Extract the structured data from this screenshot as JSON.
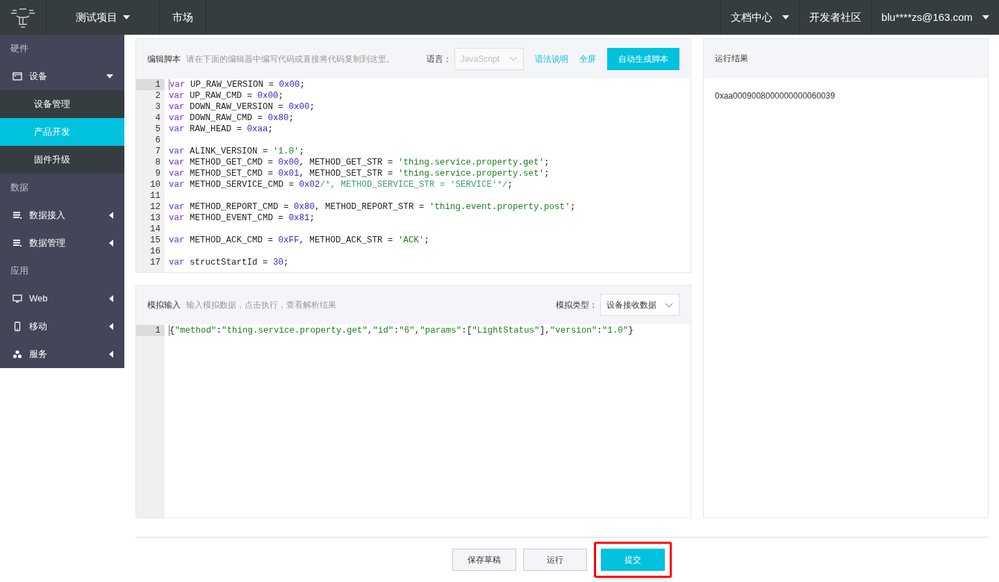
{
  "topbar": {
    "project_menu": "测试项目",
    "nav": [
      "市场"
    ],
    "right": [
      {
        "label": "文档中心",
        "kind": "menu"
      },
      {
        "label": "开发者社区",
        "kind": "link"
      },
      {
        "label": "blu****zs@163.com",
        "kind": "menu"
      }
    ]
  },
  "sidebar": {
    "sections": [
      {
        "title": "硬件",
        "items": [
          {
            "label": "设备",
            "kind": "window",
            "expanded": true,
            "children": [
              {
                "label": "设备管理",
                "selected": false
              },
              {
                "label": "产品开发",
                "selected": true
              },
              {
                "label": "固件升级",
                "selected": false
              }
            ]
          }
        ]
      },
      {
        "title": "数据",
        "items": [
          {
            "label": "数据接入",
            "kind": "list",
            "expanded": false
          },
          {
            "label": "数据管理",
            "kind": "list",
            "expanded": false
          }
        ]
      },
      {
        "title": "应用",
        "items": [
          {
            "label": "Web",
            "kind": "monitor",
            "expanded": false
          },
          {
            "label": "移动",
            "kind": "phone",
            "expanded": false
          },
          {
            "label": "服务",
            "kind": "cluster",
            "expanded": false
          }
        ]
      }
    ]
  },
  "editor": {
    "title": "编辑脚本",
    "hint": "请在下面的编辑器中编写代码或直接将代码复制到这里。",
    "language_label": "语言：",
    "language": "JavaScript",
    "links": [
      "语法说明",
      "全屏"
    ],
    "generate_button": "自动生成脚本",
    "lines": [
      {
        "number": "1",
        "active": true,
        "tokens": [
          {
            "kind": "k",
            "text": "var"
          },
          {
            "kind": "p",
            "text": " UP_RAW_VERSION = "
          },
          {
            "kind": "n",
            "text": "0x00"
          },
          {
            "kind": "p",
            "text": ";"
          }
        ]
      },
      {
        "number": "2",
        "active": false,
        "tokens": [
          {
            "kind": "k",
            "text": "var"
          },
          {
            "kind": "p",
            "text": " UP_RAW_CMD = "
          },
          {
            "kind": "n",
            "text": "0x00"
          },
          {
            "kind": "p",
            "text": ";"
          }
        ]
      },
      {
        "number": "3",
        "active": false,
        "tokens": [
          {
            "kind": "k",
            "text": "var"
          },
          {
            "kind": "p",
            "text": " DOWN_RAW_VERSION = "
          },
          {
            "kind": "n",
            "text": "0x00"
          },
          {
            "kind": "p",
            "text": ";"
          }
        ]
      },
      {
        "number": "4",
        "active": false,
        "tokens": [
          {
            "kind": "k",
            "text": "var"
          },
          {
            "kind": "p",
            "text": " DOWN_RAW_CMD = "
          },
          {
            "kind": "n",
            "text": "0x80"
          },
          {
            "kind": "p",
            "text": ";"
          }
        ]
      },
      {
        "number": "5",
        "active": false,
        "tokens": [
          {
            "kind": "k",
            "text": "var"
          },
          {
            "kind": "p",
            "text": " RAW_HEAD = "
          },
          {
            "kind": "n",
            "text": "0xaa"
          },
          {
            "kind": "p",
            "text": ";"
          }
        ]
      },
      {
        "number": "6",
        "active": false
      },
      {
        "number": "7",
        "active": false,
        "tokens": [
          {
            "kind": "k",
            "text": "var"
          },
          {
            "kind": "p",
            "text": " ALINK_VERSION = "
          },
          {
            "kind": "s",
            "text": "'1.0'"
          },
          {
            "kind": "p",
            "text": ";"
          }
        ]
      },
      {
        "number": "8",
        "active": false,
        "tokens": [
          {
            "kind": "k",
            "text": "var"
          },
          {
            "kind": "p",
            "text": " METHOD_GET_CMD = "
          },
          {
            "kind": "n",
            "text": "0x00"
          },
          {
            "kind": "p",
            "text": ", METHOD_GET_STR = "
          },
          {
            "kind": "s",
            "text": "'thing.service.property.get'"
          },
          {
            "kind": "p",
            "text": ";"
          }
        ]
      },
      {
        "number": "9",
        "active": false,
        "tokens": [
          {
            "kind": "k",
            "text": "var"
          },
          {
            "kind": "p",
            "text": " METHOD_SET_CMD = "
          },
          {
            "kind": "n",
            "text": "0x01"
          },
          {
            "kind": "p",
            "text": ", METHOD_SET_STR = "
          },
          {
            "kind": "s",
            "text": "'thing.service.property.set'"
          },
          {
            "kind": "p",
            "text": ";"
          }
        ]
      },
      {
        "number": "10",
        "active": false,
        "tokens": [
          {
            "kind": "k",
            "text": "var"
          },
          {
            "kind": "p",
            "text": " METHOD_SERVICE_CMD = "
          },
          {
            "kind": "n",
            "text": "0x02"
          },
          {
            "kind": "c",
            "text": "/*, METHOD_SERVICE_STR = 'SERVICE'*/"
          },
          {
            "kind": "p",
            "text": ";"
          }
        ]
      },
      {
        "number": "11",
        "active": false
      },
      {
        "number": "12",
        "active": false,
        "tokens": [
          {
            "kind": "k",
            "text": "var"
          },
          {
            "kind": "p",
            "text": " METHOD_REPORT_CMD = "
          },
          {
            "kind": "n",
            "text": "0x80"
          },
          {
            "kind": "p",
            "text": ", METHOD_REPORT_STR = "
          },
          {
            "kind": "s",
            "text": "'thing.event.property.post'"
          },
          {
            "kind": "p",
            "text": ";"
          }
        ]
      },
      {
        "number": "13",
        "active": false,
        "tokens": [
          {
            "kind": "k",
            "text": "var"
          },
          {
            "kind": "p",
            "text": " METHOD_EVENT_CMD = "
          },
          {
            "kind": "n",
            "text": "0x81"
          },
          {
            "kind": "p",
            "text": ";"
          }
        ]
      },
      {
        "number": "14",
        "active": false
      },
      {
        "number": "15",
        "active": false,
        "tokens": [
          {
            "kind": "k",
            "text": "var"
          },
          {
            "kind": "p",
            "text": " METHOD_ACK_CMD = "
          },
          {
            "kind": "n",
            "text": "0xFF"
          },
          {
            "kind": "p",
            "text": ", METHOD_ACK_STR = "
          },
          {
            "kind": "s",
            "text": "'ACK'"
          },
          {
            "kind": "p",
            "text": ";"
          }
        ]
      },
      {
        "number": "16",
        "active": false
      },
      {
        "number": "17",
        "active": false,
        "tokens": [
          {
            "kind": "k",
            "text": "var"
          },
          {
            "kind": "p",
            "text": " structStartId = "
          },
          {
            "kind": "n",
            "text": "30"
          },
          {
            "kind": "p",
            "text": ";"
          }
        ]
      }
    ]
  },
  "simulation": {
    "title": "模拟输入",
    "hint": "输入模拟数据，点击执行，查看解析结果",
    "type_label": "模拟类型：",
    "type": "设备接收数据",
    "lines": [
      {
        "number": "1",
        "active": true,
        "tokens": [
          {
            "kind": "p",
            "text": "{"
          },
          {
            "kind": "s",
            "text": "\"method\""
          },
          {
            "kind": "p",
            "text": ":"
          },
          {
            "kind": "s",
            "text": "\"thing.service.property.get\""
          },
          {
            "kind": "p",
            "text": ","
          },
          {
            "kind": "s",
            "text": "\"id\""
          },
          {
            "kind": "p",
            "text": ":"
          },
          {
            "kind": "s",
            "text": "\"6\""
          },
          {
            "kind": "p",
            "text": ","
          },
          {
            "kind": "s",
            "text": "\"params\""
          },
          {
            "kind": "p",
            "text": ":["
          },
          {
            "kind": "s",
            "text": "\"LightStatus\""
          },
          {
            "kind": "p",
            "text": "],"
          },
          {
            "kind": "s",
            "text": "\"version\""
          },
          {
            "kind": "p",
            "text": ":"
          },
          {
            "kind": "s",
            "text": "\"1.0\""
          },
          {
            "kind": "p",
            "text": "}"
          }
        ]
      }
    ]
  },
  "result": {
    "title": "运行结果",
    "output": "0xaa0009008000000000060039"
  },
  "actions": [
    {
      "label": "保存草稿",
      "kind": "secondary",
      "highlighted": false
    },
    {
      "label": "运行",
      "kind": "secondary",
      "highlighted": false
    },
    {
      "label": "提交",
      "kind": "primary",
      "highlighted": true
    }
  ]
}
